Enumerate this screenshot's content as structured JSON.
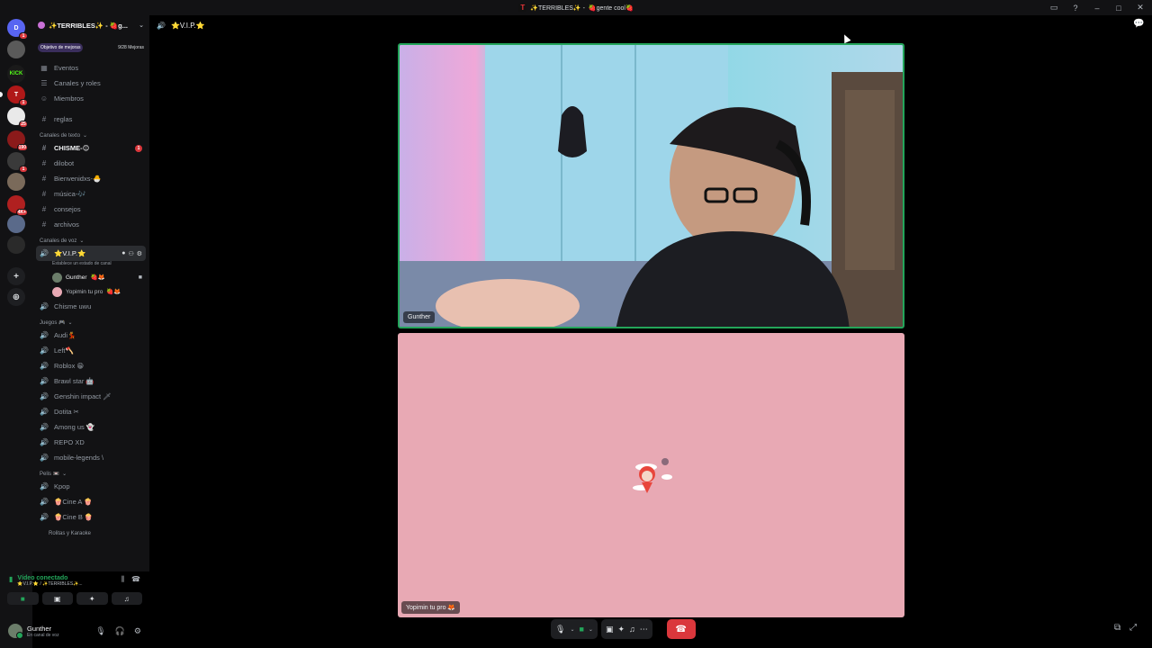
{
  "window": {
    "title_prefix": "✨TERRIBLES✨ -",
    "title_channel": "🍓gente cool🍓",
    "logo_letter": "T"
  },
  "server_rail": [
    {
      "label": "D",
      "color": "#5865f2",
      "badge": "1"
    },
    {
      "label": "",
      "color": "#5a5a5a",
      "badge": ""
    },
    {
      "label": "KICK",
      "color": "#1a1a1a",
      "badge": ""
    },
    {
      "label": "T",
      "color": "#b01818",
      "badge": "1"
    },
    {
      "label": "",
      "color": "#e9e9e9",
      "badge": "25"
    },
    {
      "label": "",
      "color": "#8b1a1a",
      "badge": "190"
    },
    {
      "label": "",
      "color": "#3a3a3a",
      "badge": "1"
    },
    {
      "label": "",
      "color": "#7a6a5a",
      "badge": ""
    },
    {
      "label": "",
      "color": "#b02020",
      "badge": "4K+"
    },
    {
      "label": "",
      "color": "#5a6a8a",
      "badge": ""
    },
    {
      "label": "",
      "color": "#2a2a2a",
      "badge": ""
    }
  ],
  "sidebar": {
    "guild_name": "✨TERRIBLES✨ - 🍓g...",
    "boost_tag": "Objetivo de mejoras",
    "boost_count": "9/28 Mejoras",
    "nav": [
      "Eventos",
      "Canales y roles",
      "Miembros"
    ],
    "rules_channel": "reglas",
    "text_category": "Canales de texto",
    "text_channels": [
      {
        "name": "CHISME-😊",
        "unread": true,
        "badge": "1"
      },
      {
        "name": "dilobot",
        "unread": false,
        "badge": ""
      },
      {
        "name": "Bienvenidxs-🐣",
        "unread": false,
        "badge": ""
      },
      {
        "name": "música-🎶",
        "unread": false,
        "badge": ""
      },
      {
        "name": "consejos",
        "unread": false,
        "badge": ""
      },
      {
        "name": "archivos",
        "unread": false,
        "badge": ""
      }
    ],
    "voice_category": "Canales de voz",
    "active_voice": "⭐V.I.P.⭐",
    "voice_status": "Establece un estado de canal",
    "voice_users": [
      {
        "name": "Gunther",
        "extra": "🍓🦊",
        "color": "#6b7d6a"
      },
      {
        "name": "Yopimin tu pro",
        "extra": "🍓🦊",
        "color": "#e8a9b4"
      }
    ],
    "voice_after": "Chisme uwu",
    "games_category": "Juegos 🎮",
    "games": [
      "Audi💃",
      "Left🪓",
      "Roblox 😁",
      "Brawl star 🤖",
      "Genshin impact 🗡",
      "Dotita ✂",
      "Among us 👻",
      "REPO XD",
      "mobile-legends \\"
    ],
    "pelis_category": "Pelis 📼",
    "pelis": [
      "Kpop",
      "🍿Cine A 🍿",
      "🍿Cine B 🍿"
    ],
    "more_category": "Rolitas y Karaoke"
  },
  "voice_panel": {
    "status": "Vídeo conectado",
    "location": "⭐V.I.P.⭐ / ✨TERRIBLES✨..."
  },
  "user": {
    "name": "Gunther",
    "status": "En canal de voz"
  },
  "call": {
    "channel": "⭐V.I.P.⭐",
    "tile1_name": "Gunther",
    "tile2_name": "Yopimin tu pro 🦊"
  }
}
